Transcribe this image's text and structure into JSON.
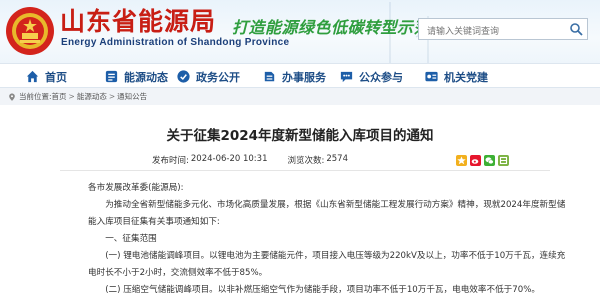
{
  "site": {
    "name_cn": "山东省能源局",
    "name_en": "Energy Administration of Shandong Province",
    "slogan": "打造能源绿色低碳转型示范区"
  },
  "search": {
    "placeholder": "请输入关键词查询"
  },
  "nav": [
    {
      "label": "首页",
      "icon": "home-icon"
    },
    {
      "label": "能源动态",
      "icon": "news-icon"
    },
    {
      "label": "政务公开",
      "icon": "government-icon"
    },
    {
      "label": "办事服务",
      "icon": "service-icon"
    },
    {
      "label": "公众参与",
      "icon": "people-icon"
    },
    {
      "label": "机关党建",
      "icon": "party-icon"
    }
  ],
  "breadcrumb": {
    "prefix": "当前位置:",
    "items": [
      "首页",
      "能源动态",
      "通知公告"
    ]
  },
  "article": {
    "title": "关于征集2024年度新型储能入库项目的通知",
    "publish_label": "发布时间:",
    "publish_time": "2024-06-20 10:31",
    "views_label": "浏览次数:",
    "views": "2574",
    "paragraphs": [
      "各市发展改革委(能源局):",
      "　　为推动全省新型储能多元化、市场化高质量发展，根据《山东省新型储能工程发展行动方案》精神，现就2024年度新型储",
      "能入库项目征集有关事项通知如下:",
      "　　一、征集范围",
      "　　(一) 锂电池储能调峰项目。以锂电池为主要储能元件，项目接入电压等级为220kV及以上，功率不低于10万千瓦，连续充",
      "电时长不小于2小时，交流侧效率不低于85%。",
      "　　(二) 压缩空气储能调峰项目。以非补燃压缩空气作为储能手段，项目功率不低于10万千瓦，电电效率不低于70%。"
    ]
  },
  "share_icons": [
    "qzone-icon",
    "weibo-icon",
    "wechat-icon",
    "favorite-icon"
  ]
}
